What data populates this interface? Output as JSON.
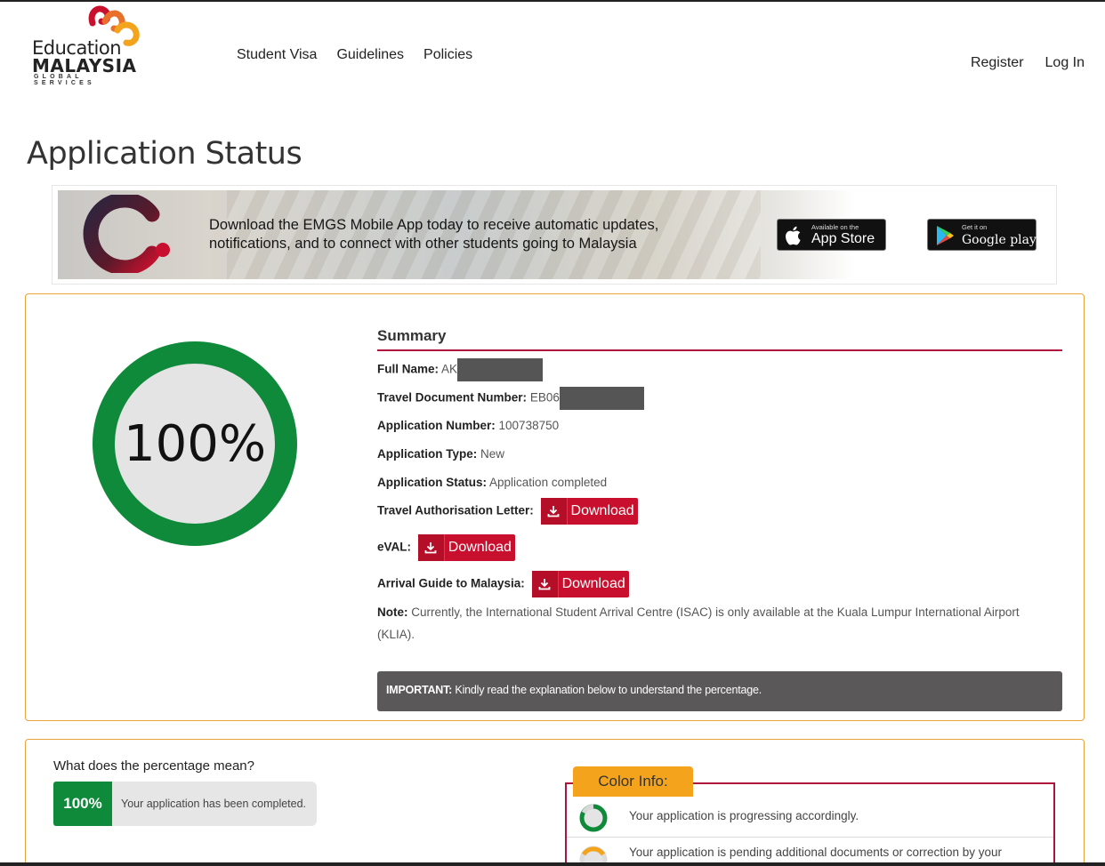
{
  "header": {
    "logo": {
      "line1": "Education",
      "line2": "MALAYSIA",
      "line3": "GLOBAL SERVICES"
    },
    "nav": [
      "Student Visa",
      "Guidelines",
      "Policies"
    ],
    "auth": {
      "register": "Register",
      "login": "Log In"
    }
  },
  "page_title": "Application Status",
  "banner": {
    "text_line1": "Download the EMGS Mobile App today to receive automatic updates,",
    "text_line2": "notifications, and to connect with other students going to Malaysia",
    "appstore": {
      "small": "Available on the",
      "big": "App Store",
      "icon": "apple-icon"
    },
    "googleplay": {
      "small": "Get it on",
      "big": "Google play",
      "icon": "google-play-icon"
    }
  },
  "progress": {
    "percent_label": "100%",
    "value": 1.0,
    "color": "#0e8a3a"
  },
  "summary": {
    "title": "Summary",
    "full_name_label": "Full Name",
    "full_name_value": "AK",
    "travel_doc_label": "Travel Document Number",
    "travel_doc_value": "EB06",
    "app_number_label": "Application Number",
    "app_number_value": "100738750",
    "app_type_label": "Application Type",
    "app_type_value": "New",
    "app_status_label": "Application Status",
    "app_status_value": "Application completed",
    "tal_label": "Travel Authorisation Letter:",
    "eval_label": "eVAL:",
    "arrival_label": "Arrival Guide to Malaysia:",
    "download_label": "Download",
    "note_label": "Note:",
    "note_text": " Currently, the International Student Arrival Centre (ISAC) is only available at the Kuala Lumpur International Airport (KLIA).",
    "important_label": "IMPORTANT:",
    "important_text": " Kindly read the explanation below to understand the percentage."
  },
  "explain": {
    "question": "What does the percentage mean?",
    "chip_pct": "100%",
    "chip_desc": "Your application has been completed.",
    "color_info_title": "Color Info:",
    "row1": "Your application is progressing accordingly.",
    "row2": "Your application is pending additional documents or correction by your"
  },
  "colors": {
    "accent_red": "#c8102e",
    "rule_red": "#b0143c",
    "card_border": "#e8a33a",
    "progress_green": "#0e8a3a",
    "color_info_tab": "#f4a41c"
  }
}
